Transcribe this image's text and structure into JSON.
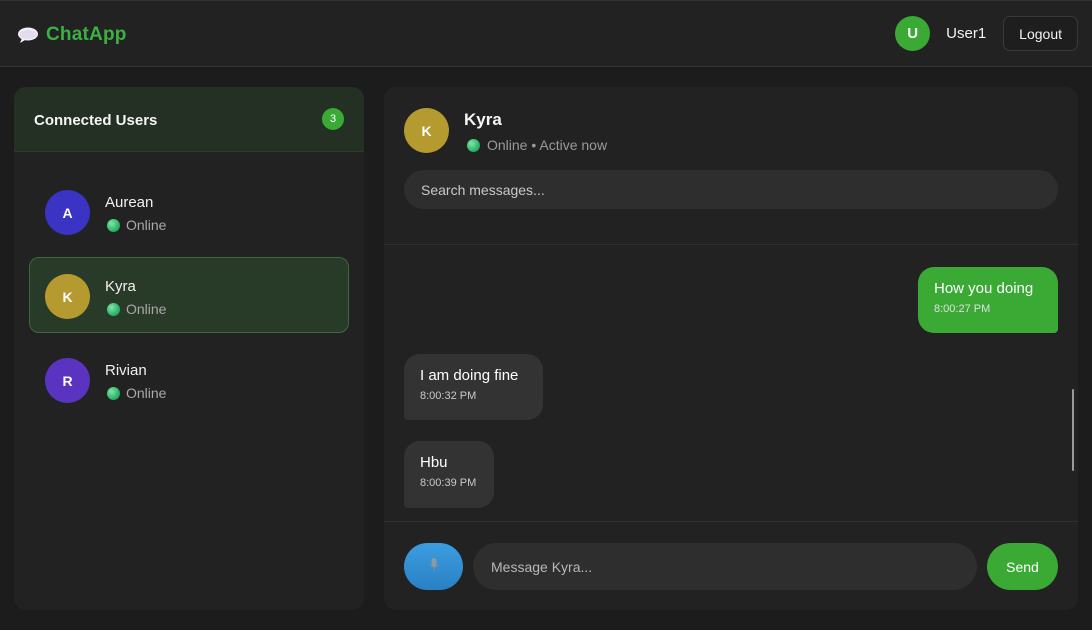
{
  "app": {
    "name": "ChatApp",
    "logo_icon": "speech-bubble-icon",
    "brand_color": "#3cb043"
  },
  "header": {
    "user_initial": "U",
    "username": "User1",
    "logout_label": "Logout"
  },
  "sidebar": {
    "title": "Connected Users",
    "count": "3",
    "users": [
      {
        "initial": "A",
        "name": "Aurean",
        "status": "Online",
        "color": "#3a33c4",
        "active": false
      },
      {
        "initial": "K",
        "name": "Kyra",
        "status": "Online",
        "color": "#b59a30",
        "active": true
      },
      {
        "initial": "R",
        "name": "Rivian",
        "status": "Online",
        "color": "#5a34c0",
        "active": false
      }
    ]
  },
  "chat": {
    "contact_initial": "K",
    "contact_name": "Kyra",
    "contact_status": "Online • Active now",
    "search_placeholder": "Search messages...",
    "messages": [
      {
        "direction": "out",
        "text": "How you doing",
        "time": "8:00:27 PM"
      },
      {
        "direction": "in",
        "text": "I am doing fine",
        "time": "8:00:32 PM"
      },
      {
        "direction": "in",
        "text": "Hbu",
        "time": "8:00:39 PM"
      }
    ],
    "input_placeholder": "Message Kyra...",
    "mic_icon": "microphone-icon",
    "send_label": "Send"
  }
}
